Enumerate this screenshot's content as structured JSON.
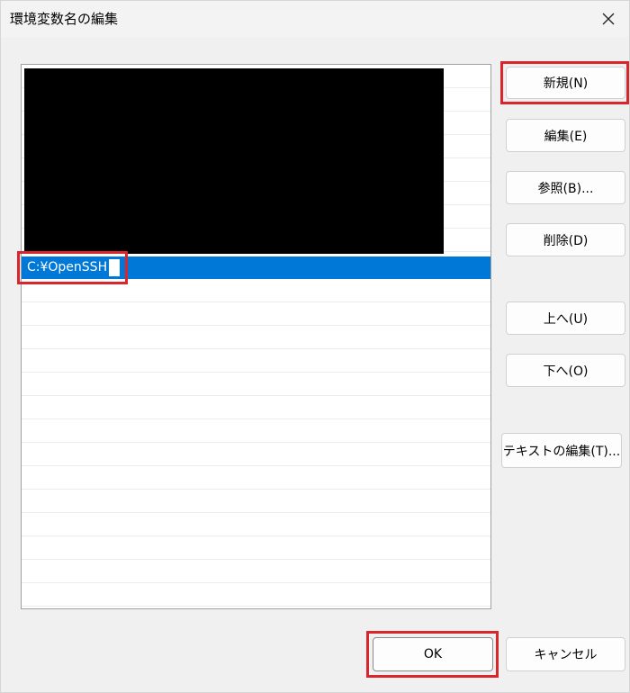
{
  "dialog": {
    "title": "環境変数名の編集",
    "close_icon": "close-icon"
  },
  "list": {
    "selected_value": "C:¥OpenSSH",
    "redacted_entries_note": ""
  },
  "buttons": {
    "new": "新規(N)",
    "edit": "編集(E)",
    "browse": "参照(B)...",
    "delete": "削除(D)",
    "move_up": "上へ(U)",
    "move_down": "下へ(O)",
    "edit_text": "テキストの編集(T)...",
    "ok": "OK",
    "cancel": "キャンセル"
  },
  "colors": {
    "selection": "#0078d7",
    "highlight_annotation": "#d9262c"
  }
}
